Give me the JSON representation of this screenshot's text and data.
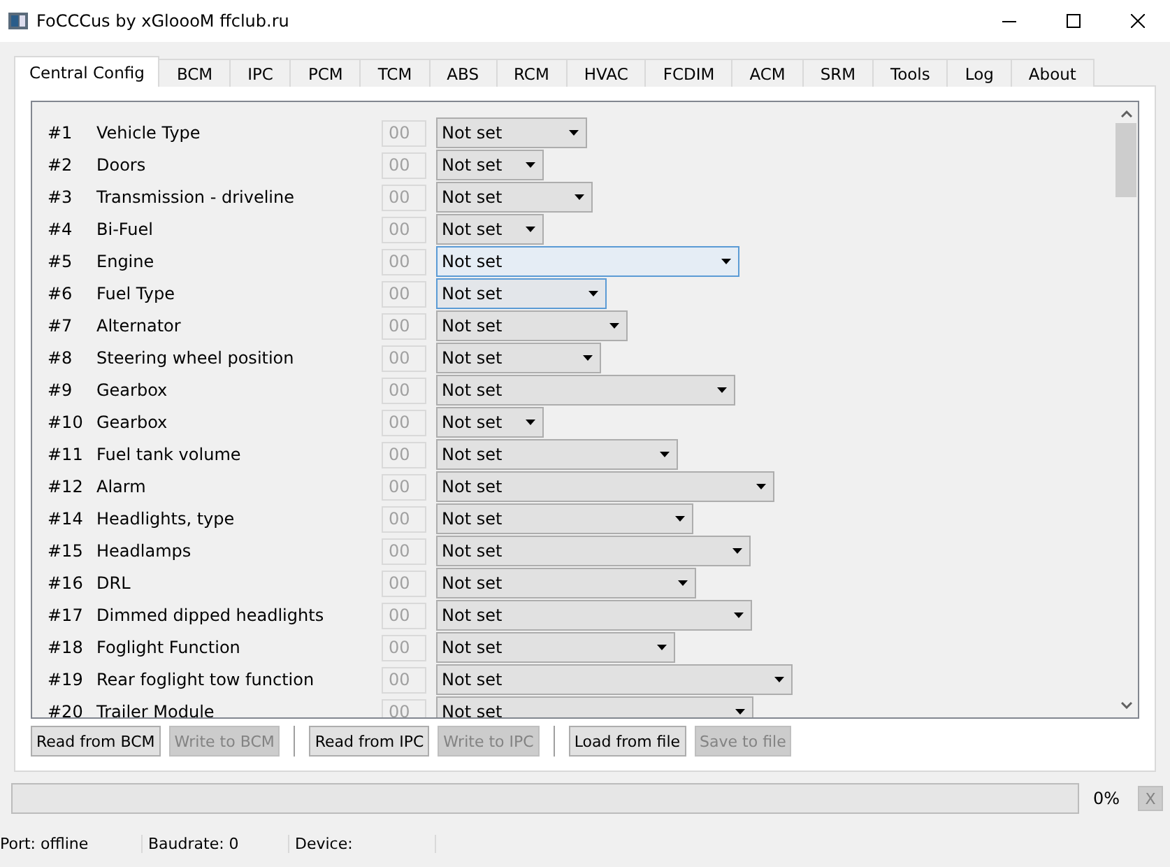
{
  "window": {
    "title": "FoCCCus by xGloooM ffclub.ru"
  },
  "tabs": [
    {
      "label": "Central Config",
      "selected": true
    },
    {
      "label": "BCM",
      "selected": false
    },
    {
      "label": "IPC",
      "selected": false
    },
    {
      "label": "PCM",
      "selected": false
    },
    {
      "label": "TCM",
      "selected": false
    },
    {
      "label": "ABS",
      "selected": false
    },
    {
      "label": "RCM",
      "selected": false
    },
    {
      "label": "HVAC",
      "selected": false
    },
    {
      "label": "FCDIM",
      "selected": false
    },
    {
      "label": "ACM",
      "selected": false
    },
    {
      "label": "SRM",
      "selected": false
    },
    {
      "label": "Tools",
      "selected": false
    },
    {
      "label": "Log",
      "selected": false
    },
    {
      "label": "About",
      "selected": false
    }
  ],
  "rows": [
    {
      "number": "#1",
      "name": "Vehicle Type",
      "code": "00",
      "value": "Not set",
      "hovered": false,
      "focused": false
    },
    {
      "number": "#2",
      "name": "Doors",
      "code": "00",
      "value": "Not set",
      "hovered": false,
      "focused": false
    },
    {
      "number": "#3",
      "name": "Transmission - driveline",
      "code": "00",
      "value": "Not set",
      "hovered": false,
      "focused": false
    },
    {
      "number": "#4",
      "name": "Bi-Fuel",
      "code": "00",
      "value": "Not set",
      "hovered": false,
      "focused": false
    },
    {
      "number": "#5",
      "name": "Engine",
      "code": "00",
      "value": "Not set",
      "hovered": true,
      "focused": false
    },
    {
      "number": "#6",
      "name": "Fuel Type",
      "code": "00",
      "value": "Not set",
      "hovered": false,
      "focused": true
    },
    {
      "number": "#7",
      "name": "Alternator",
      "code": "00",
      "value": "Not set",
      "hovered": false,
      "focused": false
    },
    {
      "number": "#8",
      "name": "Steering wheel position",
      "code": "00",
      "value": "Not set",
      "hovered": false,
      "focused": false
    },
    {
      "number": "#9",
      "name": "Gearbox",
      "code": "00",
      "value": "Not set",
      "hovered": false,
      "focused": false
    },
    {
      "number": "#10",
      "name": "Gearbox",
      "code": "00",
      "value": "Not set",
      "hovered": false,
      "focused": false
    },
    {
      "number": "#11",
      "name": "Fuel tank volume",
      "code": "00",
      "value": "Not set",
      "hovered": false,
      "focused": false
    },
    {
      "number": "#12",
      "name": "Alarm",
      "code": "00",
      "value": "Not set",
      "hovered": false,
      "focused": false
    },
    {
      "number": "#14",
      "name": "Headlights, type",
      "code": "00",
      "value": "Not set",
      "hovered": false,
      "focused": false
    },
    {
      "number": "#15",
      "name": "Headlamps",
      "code": "00",
      "value": "Not set",
      "hovered": false,
      "focused": false
    },
    {
      "number": "#16",
      "name": "DRL",
      "code": "00",
      "value": "Not set",
      "hovered": false,
      "focused": false
    },
    {
      "number": "#17",
      "name": "Dimmed dipped headlights",
      "code": "00",
      "value": "Not set",
      "hovered": false,
      "focused": false
    },
    {
      "number": "#18",
      "name": "Foglight Function",
      "code": "00",
      "value": "Not set",
      "hovered": false,
      "focused": false
    },
    {
      "number": "#19",
      "name": "Rear foglight tow function",
      "code": "00",
      "value": "Not set",
      "hovered": false,
      "focused": false
    },
    {
      "number": "#20",
      "name": "Trailer Module",
      "code": "00",
      "value": "Not set",
      "hovered": false,
      "focused": false
    }
  ],
  "buttons": [
    {
      "label": "Read from BCM",
      "disabled": false
    },
    {
      "label": "Write to BCM",
      "disabled": true
    },
    {
      "label": "Read from IPC",
      "disabled": false
    },
    {
      "label": "Write to IPC",
      "disabled": true
    },
    {
      "label": "Load from file",
      "disabled": false
    },
    {
      "label": "Save to file",
      "disabled": true
    }
  ],
  "progress": {
    "level": 0,
    "reading": "0%",
    "cancel": "X"
  },
  "status_bar": [
    "Port: offline",
    "Baudrate: 0",
    "Device:"
  ]
}
